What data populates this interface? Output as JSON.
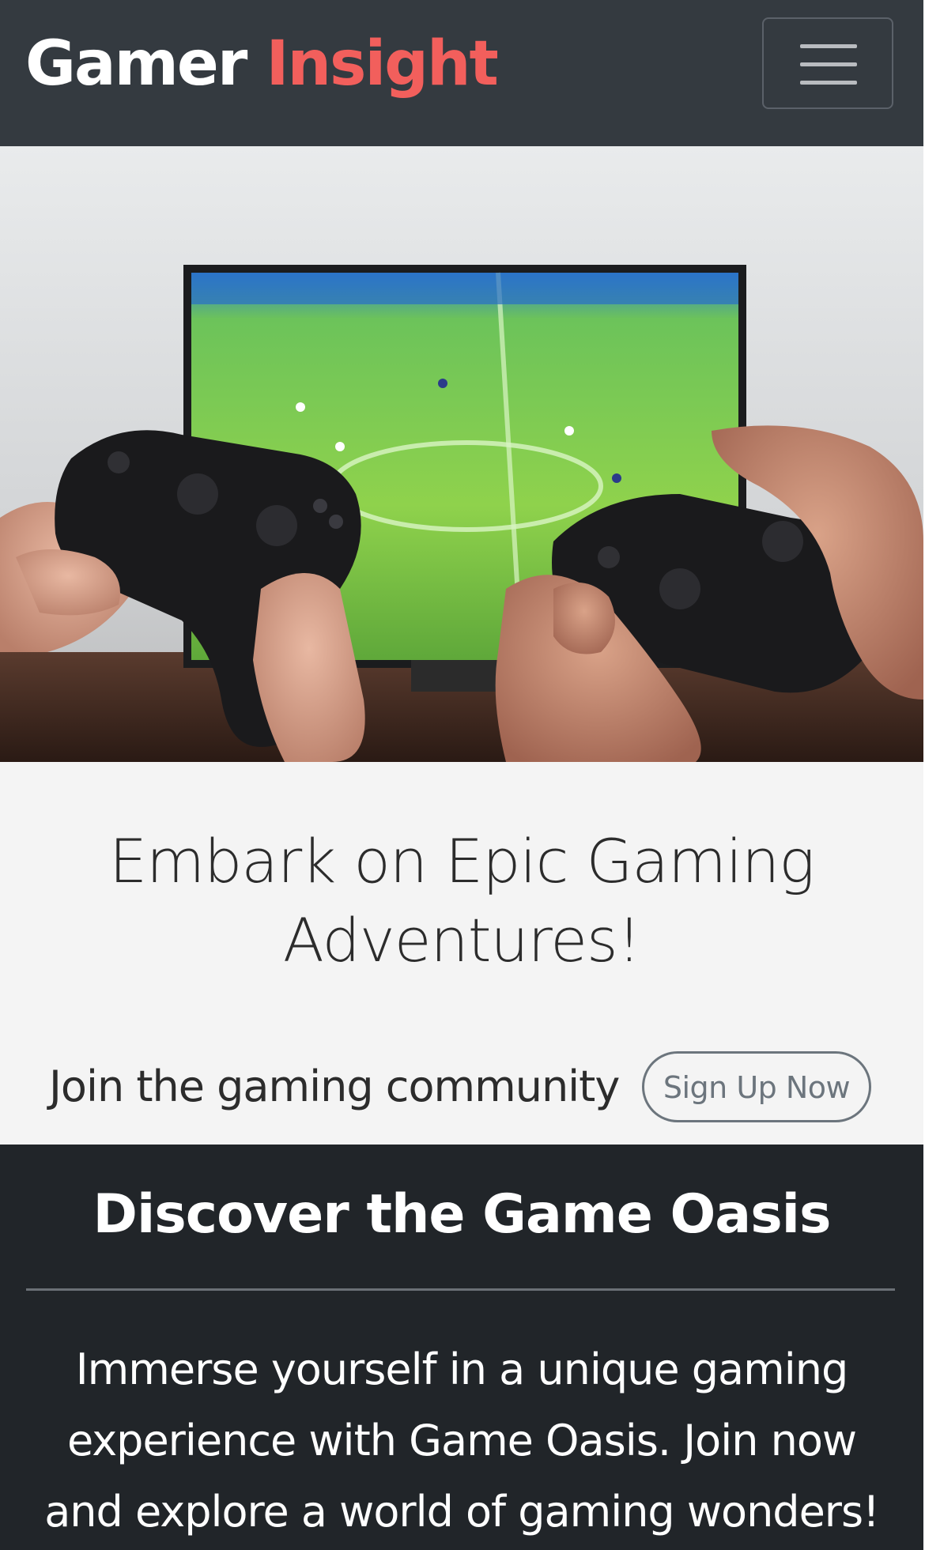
{
  "navbar": {
    "brand_primary": "Gamer",
    "brand_accent": "Insight",
    "brand_accent_color": "#f25f5c",
    "toggler_icon": "hamburger-menu-icon"
  },
  "hero": {
    "image_subject": "two-hands-holding-game-controllers-in-front-of-tv-showing-soccer-game"
  },
  "jumbotron": {
    "heading": "Embark on Epic Gaming Adventures!",
    "cta_text": "Join the gaming community",
    "cta_button": "Sign Up Now"
  },
  "oasis": {
    "heading": "Discover the Game Oasis",
    "description": "Immerse yourself in a unique gaming experience with Game Oasis. Join now and explore a world of gaming wonders!"
  },
  "colors": {
    "navbar_bg": "#343a40",
    "jumbotron_bg": "#f4f4f4",
    "section_dark_bg": "#212529",
    "accent": "#f25f5c"
  }
}
